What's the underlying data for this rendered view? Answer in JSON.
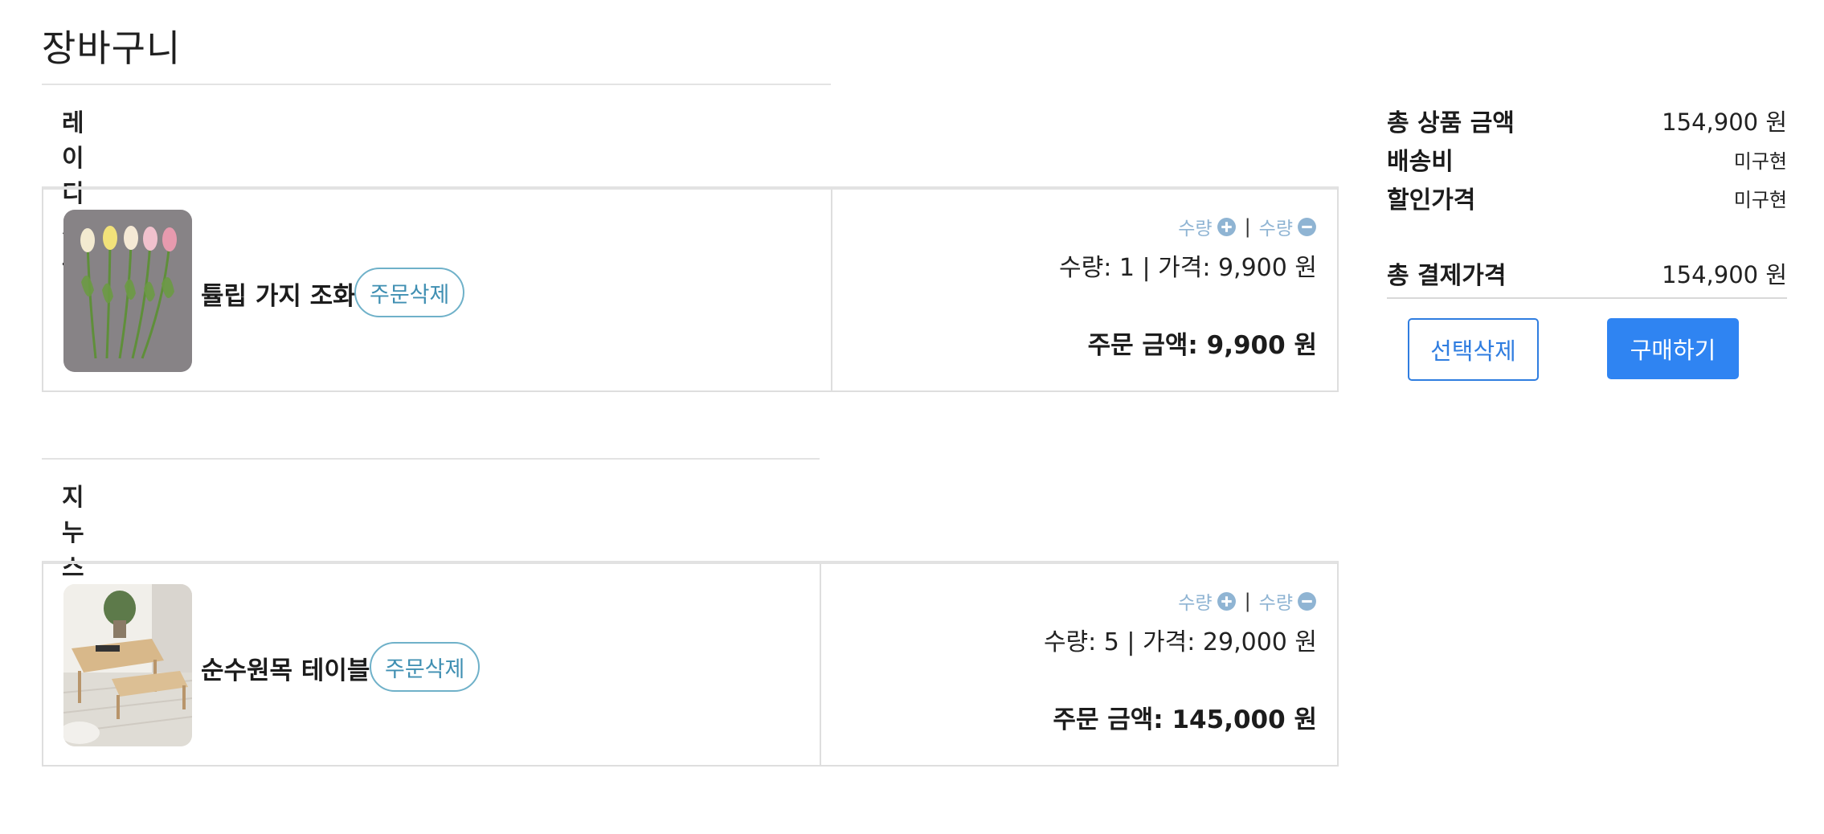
{
  "page": {
    "title": "장바구니"
  },
  "shops": [
    {
      "name": "레이디가구",
      "item": {
        "name": "튤립 가지 조화",
        "image": "tulip-bouquet-photo",
        "delete_label": "주문삭제",
        "qty_plus_label": "수량",
        "qty_minus_label": "수량",
        "qty_separator": "|",
        "qty_price": "수량: 1 | 가격: 9,900 원",
        "order_amount": "주문 금액: 9,900 원"
      }
    },
    {
      "name": "지누스",
      "item": {
        "name": "순수원목 테이블",
        "image": "wooden-table-photo",
        "delete_label": "주문삭제",
        "qty_plus_label": "수량",
        "qty_minus_label": "수량",
        "qty_separator": "|",
        "qty_price": "수량: 5 | 가격: 29,000 원",
        "order_amount": "주문 금액: 145,000 원"
      }
    }
  ],
  "summary": {
    "total_label": "총 상품 금액",
    "total_value": "154,900 원",
    "shipping_label": "배송비",
    "shipping_value": "미구현",
    "discount_label": "할인가격",
    "discount_value": "미구현",
    "payment_label": "총 결제가격",
    "payment_value": "154,900 원"
  },
  "actions": {
    "delete_selected_label": "선택삭제",
    "purchase_label": "구매하기"
  },
  "icons": {
    "plus": "plus-circle-icon",
    "minus": "minus-circle-icon"
  },
  "colors": {
    "accent": "#2f84f2",
    "delete_button": "#3f8fb2",
    "qty_control": "#8fb4d3"
  }
}
